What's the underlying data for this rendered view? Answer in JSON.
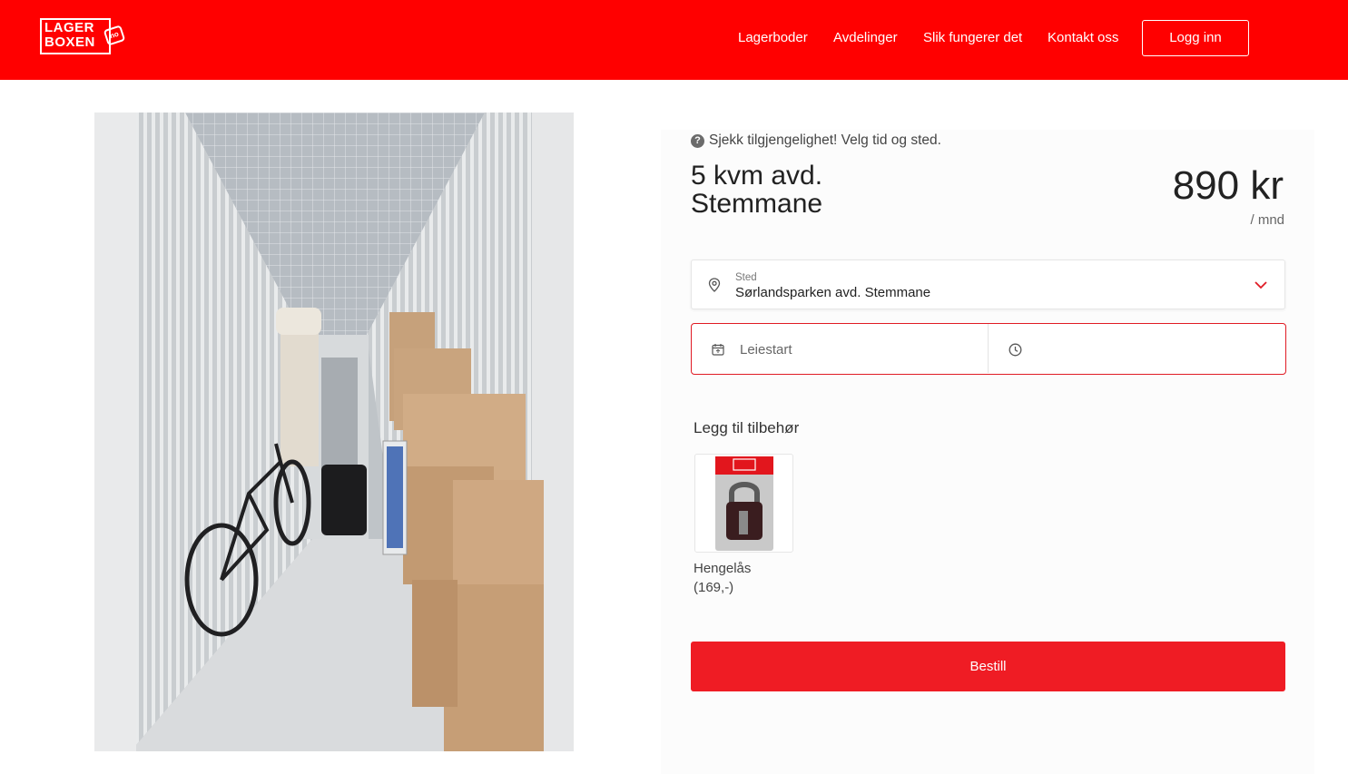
{
  "brand": {
    "logo_line1": "LAGER",
    "logo_line2": "BOXEN",
    "logo_badge": "no"
  },
  "nav": {
    "items": [
      "Lagerboder",
      "Avdelinger",
      "Slik fungerer det",
      "Kontakt oss"
    ],
    "login_label": "Logg inn"
  },
  "product": {
    "availability_text": "Sjekk tilgjengelighet! Velg tid og sted.",
    "title_line1": "5 kvm avd.",
    "title_line2": "Stemmane",
    "price": "890 kr",
    "period": "/ mnd"
  },
  "form": {
    "location_label": "Sted",
    "location_value": "Sørlandsparken avd. Stemmane",
    "start_placeholder": "Leiestart"
  },
  "accessories": {
    "heading": "Legg til tilbehør",
    "items": [
      {
        "name": "Hengelås",
        "price": "(169,-)"
      }
    ]
  },
  "order_label": "Bestill",
  "colors": {
    "brand_red": "#ff0000",
    "button_red": "#ef1c24",
    "border_red": "#e01b24"
  },
  "icons": [
    "question-icon",
    "location-pin-icon",
    "chevron-down-icon",
    "calendar-icon",
    "clock-icon"
  ]
}
